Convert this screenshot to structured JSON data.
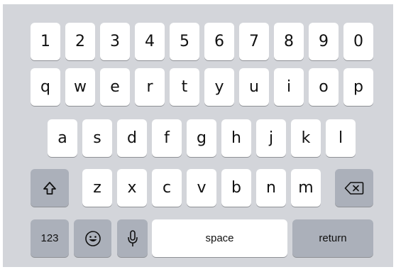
{
  "keyboard": {
    "row1": [
      "1",
      "2",
      "3",
      "4",
      "5",
      "6",
      "7",
      "8",
      "9",
      "0"
    ],
    "row2": [
      "q",
      "w",
      "e",
      "r",
      "t",
      "y",
      "u",
      "i",
      "o",
      "p"
    ],
    "row3": [
      "a",
      "s",
      "d",
      "f",
      "g",
      "h",
      "j",
      "k",
      "l"
    ],
    "row4": [
      "z",
      "x",
      "c",
      "v",
      "b",
      "n",
      "m"
    ],
    "numbers_label": "123",
    "space_label": "space",
    "return_label": "return",
    "icons": {
      "shift": "shift-icon",
      "backspace": "backspace-icon",
      "emoji": "emoji-icon",
      "mic": "microphone-icon"
    },
    "colors": {
      "background": "#d3d5da",
      "key": "#ffffff",
      "function_key": "#abb0ba"
    }
  }
}
